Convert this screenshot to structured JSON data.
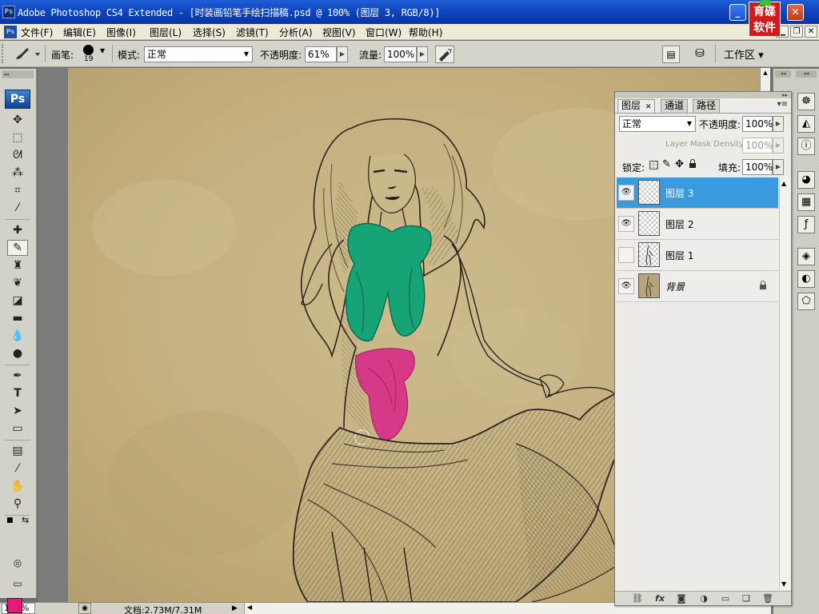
{
  "window": {
    "title": "Adobe Photoshop CS4 Extended - [时装画铅笔手绘扫描稿.psd @ 100% (图层 3, RGB/8)]",
    "app_badge": "Ps",
    "minimize": "_",
    "close": "✕",
    "logo_text": "育碟\n软件"
  },
  "menubar": {
    "items": [
      {
        "label": "文件(F)",
        "id": "file"
      },
      {
        "label": "编辑(E)",
        "id": "edit"
      },
      {
        "label": "图像(I)",
        "id": "image"
      },
      {
        "label": "图层(L)",
        "id": "layer"
      },
      {
        "label": "选择(S)",
        "id": "select"
      },
      {
        "label": "滤镜(T)",
        "id": "filter"
      },
      {
        "label": "分析(A)",
        "id": "analysis"
      },
      {
        "label": "视图(V)",
        "id": "view"
      },
      {
        "label": "窗口(W)",
        "id": "window"
      },
      {
        "label": "帮助(H)",
        "id": "help"
      }
    ]
  },
  "options": {
    "brush_label": "画笔:",
    "brush_size": "19",
    "mode_label": "模式:",
    "mode_value": "正常",
    "opacity_label": "不透明度:",
    "opacity_value": "61%",
    "flow_label": "流量:",
    "flow_value": "100%",
    "workspace_label": "工作区 ▾"
  },
  "toolbox": {
    "badge": "Ps",
    "foreground_color": "#e8197a",
    "background_color": "#ffffff"
  },
  "statusbar": {
    "zoom": "100%",
    "doc_info": "文档:2.73M/7.31M"
  },
  "layers_panel": {
    "tabs": [
      {
        "label": "图层",
        "active": true
      },
      {
        "label": "通道",
        "active": false
      },
      {
        "label": "路径",
        "active": false
      }
    ],
    "blend_mode": "正常",
    "opacity_label": "不透明度:",
    "opacity_value": "100%",
    "mask_density_label": "Layer Mask Density",
    "mask_density_value": "100%",
    "lock_label": "锁定:",
    "fill_label": "填充:",
    "fill_value": "100%",
    "layers": [
      {
        "name": "图层 3",
        "visible": true,
        "selected": true,
        "locked": false
      },
      {
        "name": "图层 2",
        "visible": true,
        "selected": false,
        "locked": false
      },
      {
        "name": "图层 1",
        "visible": false,
        "selected": false,
        "locked": false
      },
      {
        "name": "背景",
        "visible": true,
        "selected": false,
        "locked": true
      }
    ]
  },
  "artwork": {
    "paper_color": "#c6b383",
    "scarf_color": "#16a378",
    "sash_color": "#d8338a",
    "ink_color": "#2a2520"
  }
}
